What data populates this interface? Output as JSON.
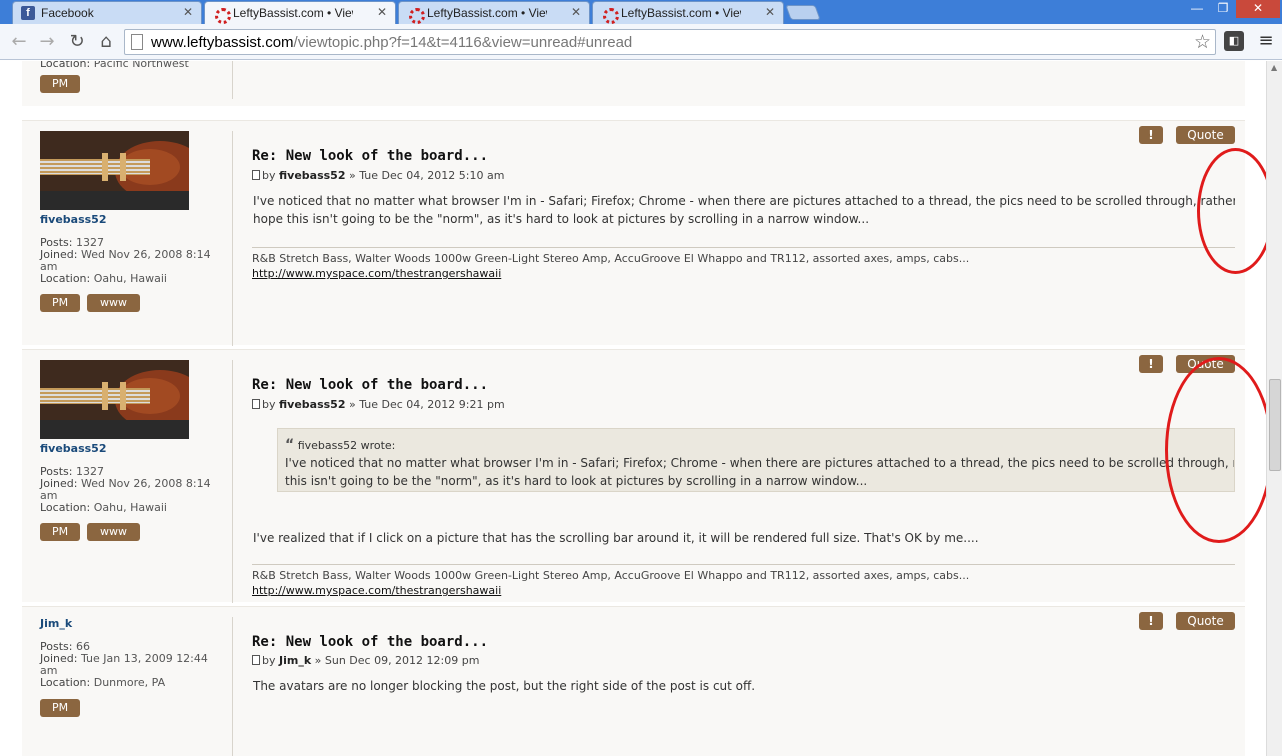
{
  "browser": {
    "tabs": [
      {
        "title": "Facebook",
        "icon": "facebook-icon"
      },
      {
        "title": "LeftyBassist.com • View to",
        "icon": "leftybassist-icon"
      },
      {
        "title": "LeftyBassist.com • View to",
        "icon": "leftybassist-icon"
      },
      {
        "title": "LeftyBassist.com • View to",
        "icon": "leftybassist-icon"
      }
    ],
    "active_tab": 1,
    "url_host": "www.leftybassist.com",
    "url_path": "/viewtopic.php?f=14&t=4116&view=unread#unread"
  },
  "top_fragment": {
    "location_label": "Location:",
    "location_value": "Pacific Northwest",
    "pm_label": "PM"
  },
  "posts": [
    {
      "username": "fivebass52",
      "posts_label": "Posts:",
      "posts_value": "1327",
      "joined_label": "Joined:",
      "joined_value": "Wed Nov 26, 2008 8:14",
      "joined_value_2": "am",
      "location_label": "Location:",
      "location_value": "Oahu, Hawaii",
      "pm_label": "PM",
      "www_label": "www",
      "report_label": "!",
      "quote_label": "Quote",
      "title": "Re: New look of the board...",
      "by": "by",
      "author": "fivebass52",
      "date": "» Tue Dec 04, 2012 5:10 am",
      "body_line1": "I've noticed that no matter what browser I'm in - Safari; Firefox; Chrome - when there are pictures attached to a thread, the pics need to be scrolled through, rather th",
      "body_line2": "hope this isn't going to be the \"norm\", as it's hard to look at pictures by scrolling in a narrow window...",
      "signature": "R&B Stretch Bass, Walter Woods 1000w Green-Light Stereo Amp, AccuGroove El Whappo and TR112, assorted axes, amps, cabs...",
      "signature_link": "http://www.myspace.com/thestrangershawaii"
    },
    {
      "username": "fivebass52",
      "posts_label": "Posts:",
      "posts_value": "1327",
      "joined_label": "Joined:",
      "joined_value": "Wed Nov 26, 2008 8:14",
      "joined_value_2": "am",
      "location_label": "Location:",
      "location_value": "Oahu, Hawaii",
      "pm_label": "PM",
      "www_label": "www",
      "report_label": "!",
      "quote_label": "Quote",
      "title": "Re: New look of the board...",
      "by": "by",
      "author": "fivebass52",
      "date": "» Tue Dec 04, 2012 9:21 pm",
      "quote_cite": "fivebass52 wrote:",
      "quote_line1": "I've noticed that no matter what browser I'm in - Safari; Firefox; Chrome - when there are pictures attached to a thread, the pics need to be scrolled through, rather than",
      "quote_line2": "this isn't going to be the \"norm\", as it's hard to look at pictures by scrolling in a narrow window...",
      "body_line1": "I've realized that if I click on a picture that has the scrolling bar around it, it will be rendered full size. That's OK by me....",
      "signature": "R&B Stretch Bass, Walter Woods 1000w Green-Light Stereo Amp, AccuGroove El Whappo and TR112, assorted axes, amps, cabs...",
      "signature_link": "http://www.myspace.com/thestrangershawaii"
    },
    {
      "username": "Jim_k",
      "posts_label": "Posts:",
      "posts_value": "66",
      "joined_label": "Joined:",
      "joined_value": "Tue Jan 13, 2009 12:44",
      "joined_value_2": "am",
      "location_label": "Location:",
      "location_value": "Dunmore, PA",
      "pm_label": "PM",
      "report_label": "!",
      "quote_label": "Quote",
      "title": "Re: New look of the board...",
      "by": "by",
      "author": "Jim_k",
      "date": "» Sun Dec 09, 2012 12:09 pm",
      "body_line1": "The avatars are no longer blocking the post, but the right side of the post is cut off."
    }
  ],
  "colors": {
    "button_brown": "#8b6640",
    "annotation_red": "#e01b1b",
    "tabbar_blue": "#3d7ed8"
  }
}
